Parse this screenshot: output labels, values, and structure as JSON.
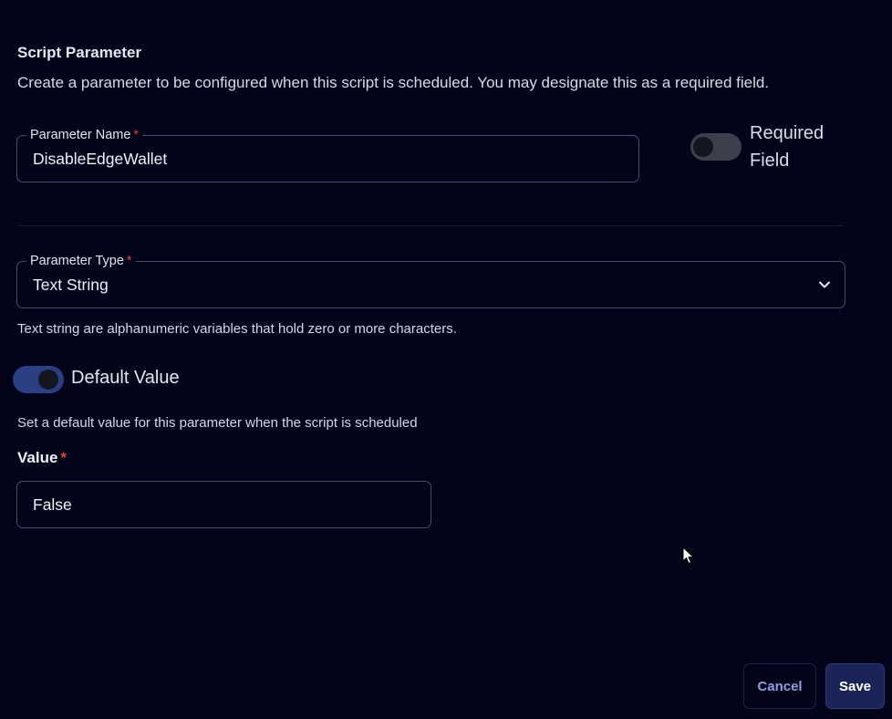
{
  "section": {
    "title": "Script Parameter",
    "description": "Create a parameter to be configured when this script is scheduled. You may designate this as a required field."
  },
  "parameter_name": {
    "label": "Parameter Name",
    "required_marker": "*",
    "value": "DisableEdgeWallet"
  },
  "required_field": {
    "label_line1": "Required",
    "label_line2": "Field",
    "enabled": false
  },
  "parameter_type": {
    "label": "Parameter Type",
    "required_marker": "*",
    "selected": "Text String",
    "help": "Text string are alphanumeric variables that hold zero or more characters."
  },
  "default_value": {
    "toggle_label": "Default Value",
    "enabled": true,
    "help": "Set a default value for this parameter when the script is scheduled",
    "value_label": "Value",
    "required_marker": "*",
    "value": "False"
  },
  "actions": {
    "cancel_label": "Cancel",
    "save_label": "Save"
  },
  "icons": {
    "dropdown": "chevron-down-icon",
    "pointer": "mouse-cursor-icon"
  },
  "colors": {
    "background": "#03031a",
    "accent": "#2b3f86",
    "required": "#e0453f",
    "cancel_text": "#8aa0de",
    "save_bg": "#1b2458"
  }
}
